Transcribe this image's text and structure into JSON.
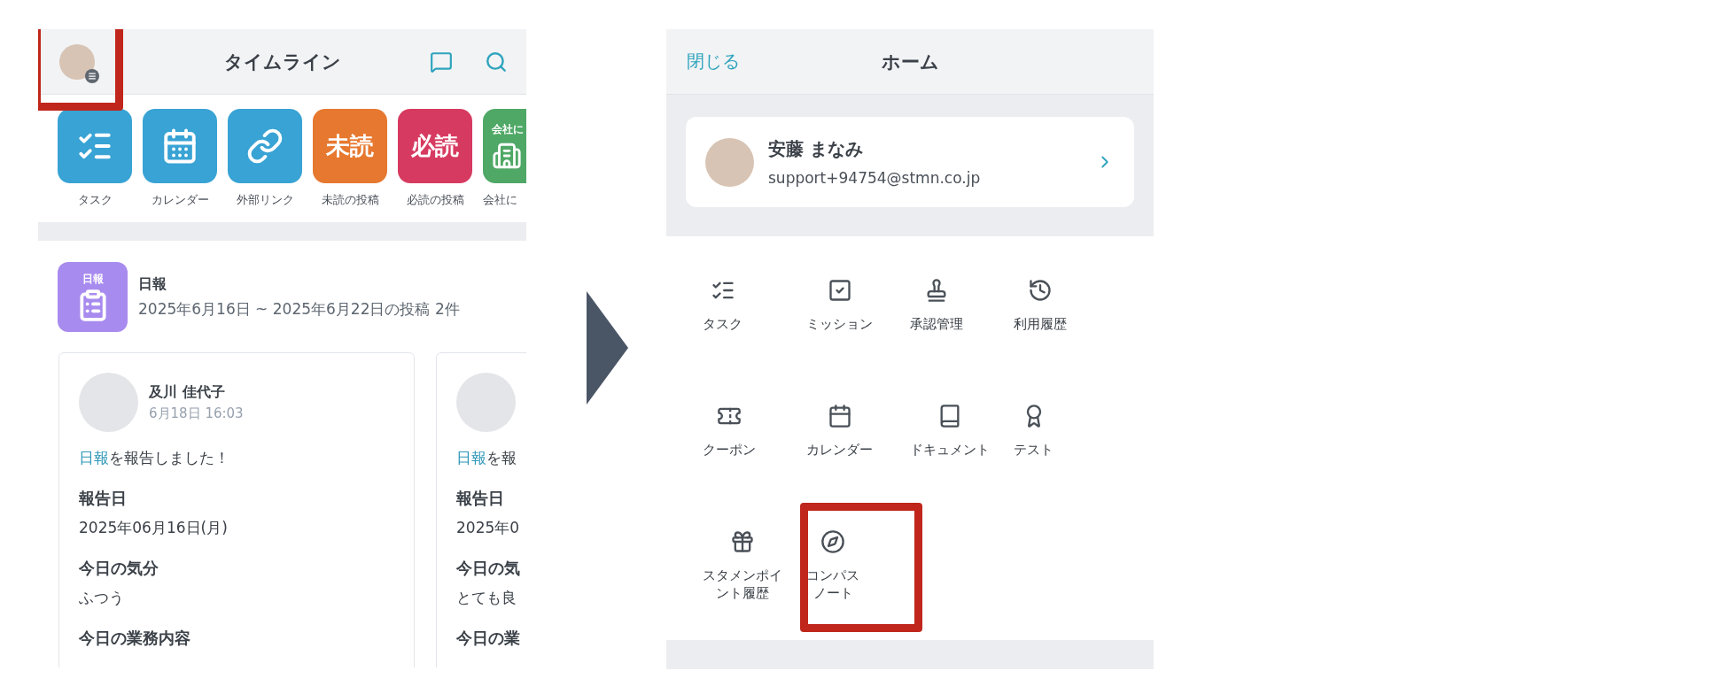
{
  "timeline": {
    "avatar": {
      "highlighted": true
    },
    "title": "タイムライン",
    "shortcuts": [
      {
        "kind": "icon",
        "label": "タスク",
        "color": "#38a3d4"
      },
      {
        "kind": "icon",
        "label": "カレンダー",
        "color": "#38a3d4"
      },
      {
        "kind": "icon",
        "label": "外部リンク",
        "color": "#38a3d4"
      },
      {
        "kind": "text",
        "text": "未読",
        "label": "未読の投稿",
        "color": "#e6782f"
      },
      {
        "kind": "text",
        "text": "必読",
        "label": "必読の投稿",
        "color": "#d73a60"
      },
      {
        "kind": "banner",
        "text": "会社に",
        "label": "会社に",
        "color": "#4fa866"
      }
    ],
    "digest": {
      "badge": "日報",
      "title": "日報",
      "subtitle": "2025年6月16日 ~ 2025年6月22日の投稿 2件"
    },
    "posts": [
      {
        "name": "及川 佳代子",
        "time": "6月18日 16:03",
        "link": "日報",
        "message": "を報告しました！",
        "fields": [
          {
            "label": "報告日",
            "value": "2025年06月16日(月)"
          },
          {
            "label": "今日の気分",
            "value": "ふつう"
          },
          {
            "label": "今日の業務内容"
          }
        ]
      },
      {
        "link": "日報",
        "message": "を報",
        "fields": [
          {
            "label": "報告日",
            "value": "2025年0"
          },
          {
            "label": "今日の気",
            "value": "とても良"
          },
          {
            "label": "今日の業"
          }
        ]
      }
    ]
  },
  "home": {
    "close": "閉じる",
    "title": "ホーム",
    "profile": {
      "name": "安藤 まなみ",
      "email": "support+94754@stmn.co.jp"
    },
    "menu": [
      {
        "lines": [
          "タスク"
        ],
        "highlighted": false
      },
      {
        "lines": [
          "ミッション"
        ],
        "highlighted": false
      },
      {
        "lines": [
          "承認管理"
        ],
        "highlighted": false
      },
      {
        "lines": [
          "利用履歴"
        ],
        "highlighted": false
      },
      {
        "lines": [
          "クーポン"
        ],
        "highlighted": false
      },
      {
        "lines": [
          "カレンダー"
        ],
        "highlighted": false
      },
      {
        "lines": [
          "ドキュメント"
        ],
        "highlighted": false
      },
      {
        "lines": [
          "テスト"
        ],
        "highlighted": false
      },
      {
        "lines": [
          "スタメンポイ",
          "ント履歴"
        ],
        "highlighted": false
      },
      {
        "lines": [
          "コンパス",
          "ノート"
        ],
        "highlighted": true
      }
    ]
  }
}
